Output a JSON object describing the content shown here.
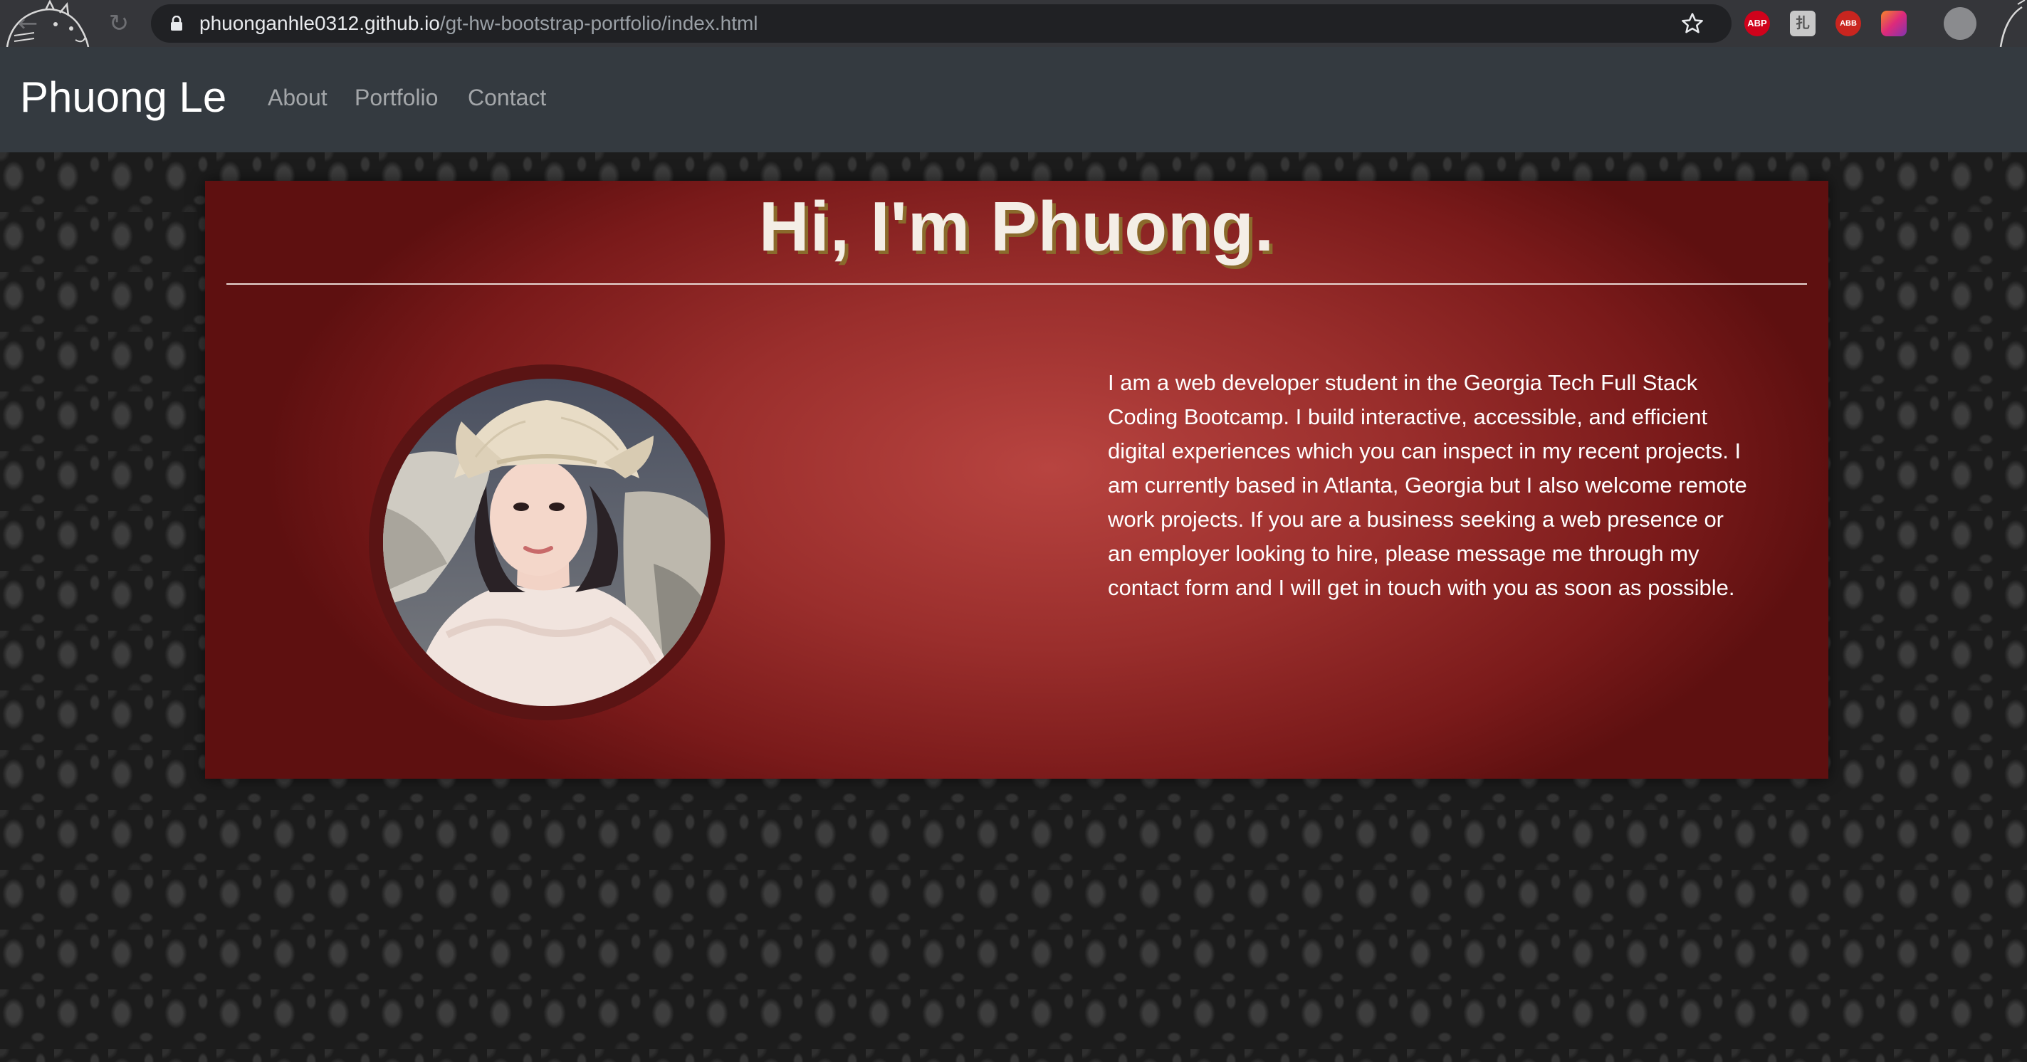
{
  "browser": {
    "url_host": "phuonganhle0312.github.io",
    "url_path": "/gt-hw-bootstrap-portfolio/index.html",
    "extensions": [
      {
        "name": "adblock-plus-icon",
        "label": "ABP"
      },
      {
        "name": "extension-icon",
        "label": "扎"
      },
      {
        "name": "adblock-icon",
        "label": "ABB"
      },
      {
        "name": "instagram-extension-icon",
        "label": ""
      }
    ]
  },
  "navbar": {
    "brand": "Phuong Le",
    "links": [
      "About",
      "Portfolio",
      "Contact"
    ]
  },
  "hero": {
    "title": "Hi, I'm Phuong.",
    "bio": "I am a web developer student in the Georgia Tech Full Stack Coding Bootcamp. I build interactive, accessible, and efficient digital experiences which you can inspect in my recent projects. I am currently based in Atlanta, Georgia but I also welcome remote work projects. If you are a business seeking a web presence or an employer looking to hire, please message me through my contact form and I will get in touch with you as soon as possible."
  }
}
